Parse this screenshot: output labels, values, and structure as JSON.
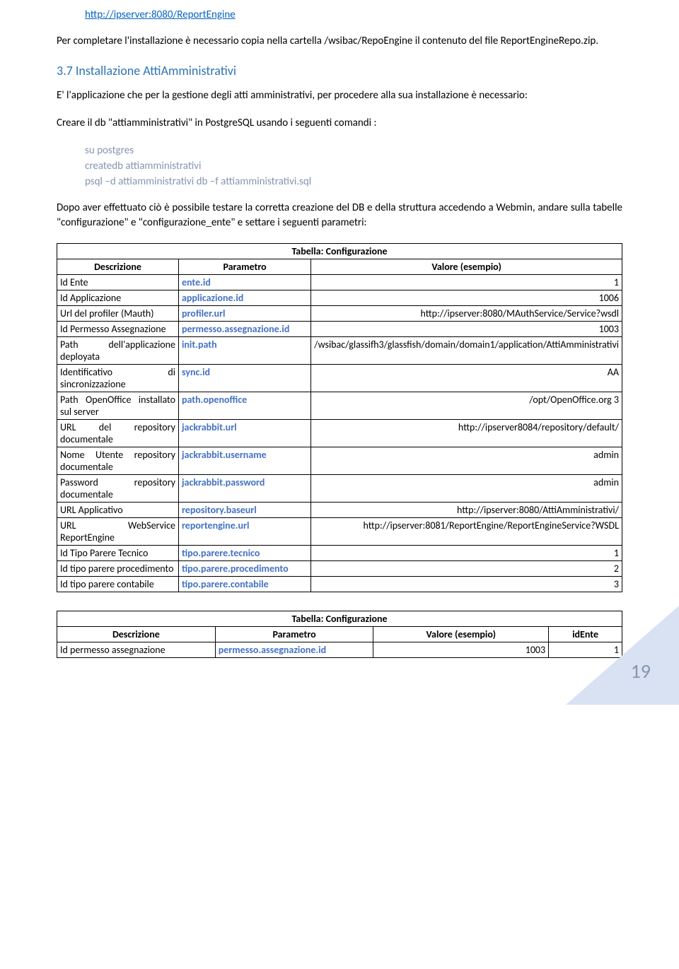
{
  "url": "http://ipserver:8080/ReportEngine",
  "para_intro": "Per completare l'installazione è necessario copia nella cartella /wsibac/RepoEngine il contenuto del file ReportEngineRepo.zip.",
  "section_heading": "3.7 Installazione AttiAmministrativi",
  "para_app": "E' l'applicazione che per la gestione degli atti amministrativi, per procedere alla sua installazione è necessario:",
  "para_db": "Creare il db \"attiamministrativi\" in PostgreSQL usando i seguenti comandi :",
  "code": {
    "l1": "su postgres",
    "l2": "createdb attiamministrativi",
    "l3": "psql –d attiamministrativi db –f attiamministrativi.sql"
  },
  "para_after": "Dopo aver effettuato ciò è possibile testare la corretta creazione del DB e della struttura accedendo a Webmin, andare sulla tabelle \"configurazione\" e \"configurazione_ente\" e settare i seguenti parametri:",
  "t1": {
    "title": "Tabella: Configurazione",
    "h1": "Descrizione",
    "h2": "Parametro",
    "h3": "Valore (esempio)",
    "rows": [
      {
        "d": "Id Ente",
        "p": "ente.id",
        "v": "1"
      },
      {
        "d": "Id Applicazione",
        "p": "applicazione.id",
        "v": "1006"
      },
      {
        "d": "Url del profiler (Mauth)",
        "p": "profiler.url",
        "v": "http://ipserver:8080/MAuthService/Service?wsdl"
      },
      {
        "d": "Id Permesso Assegnazione",
        "p": "permesso.assegnazione.id",
        "v": "1003"
      },
      {
        "d": "Path dell'applicazione deployata",
        "p": "init.path",
        "v": "/wsibac/glassifh3/glassfish/domain/domain1/application/AttiAmministrativi"
      },
      {
        "d": "Identificativo di sincronizzazione",
        "p": "sync.id",
        "v": "AA"
      },
      {
        "d": "Path OpenOffice installato sul server",
        "p": "path.openoffice",
        "v": "/opt/OpenOffice.org 3"
      },
      {
        "d": "URL del repository documentale",
        "p": "jackrabbit.url",
        "v": "http://ipserver8084/repository/default/"
      },
      {
        "d": "Nome Utente repository documentale",
        "p": "jackrabbit.username",
        "v": "admin"
      },
      {
        "d": "Password repository documentale",
        "p": "jackrabbit.password",
        "v": "admin"
      },
      {
        "d": "URL Applicativo",
        "p": "repository.baseurl",
        "v": "http://ipserver:8080/AttiAmministrativi/"
      },
      {
        "d": "URL WebService ReportEngine",
        "p": "reportengine.url",
        "v": "http://ipserver:8081/ReportEngine/ReportEngineService?WSDL"
      },
      {
        "d": "Id Tipo Parere Tecnico",
        "p": "tipo.parere.tecnico",
        "v": "1"
      },
      {
        "d": "Id tipo parere procedimento",
        "p": "tipo.parere.procedimento",
        "v": "2"
      },
      {
        "d": "Id tipo parere contabile",
        "p": "tipo.parere.contabile",
        "v": "3"
      }
    ]
  },
  "t2": {
    "title": "Tabella: Configurazione",
    "h1": "Descrizione",
    "h2": "Parametro",
    "h3": "Valore (esempio)",
    "h4": "idEnte",
    "rows": [
      {
        "d": "Id permesso assegnazione",
        "p": "permesso.assegnazione.id",
        "v": "1003",
        "i": "1"
      }
    ]
  },
  "page_number": "19"
}
